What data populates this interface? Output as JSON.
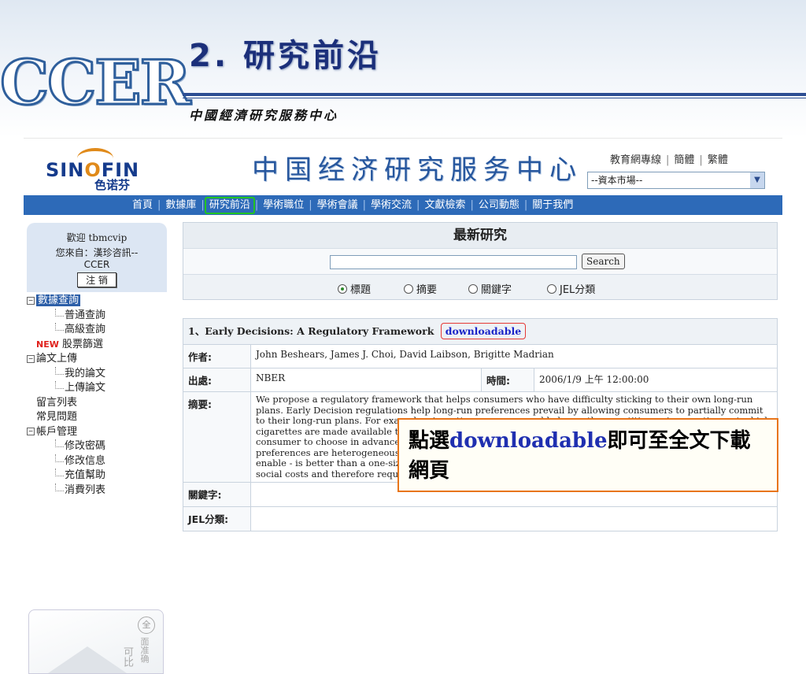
{
  "slide": {
    "logo_text": "CCER",
    "title": "2. 研究前沿",
    "subtitle": "中國經濟研究服務中心"
  },
  "site": {
    "logo_en_pre": "SIN",
    "logo_en_o": "O",
    "logo_en_post": "FIN",
    "logo_cn": "色诺芬",
    "name": "中国经济研究服务中心",
    "top_links": [
      "教育網專線",
      "簡體",
      "繁體"
    ],
    "market_select": {
      "value": "--資本市場--"
    }
  },
  "nav": {
    "items": [
      "首頁",
      "數據庫",
      "研究前沿",
      "學術職位",
      "學術會議",
      "學術交流",
      "文獻檢索",
      "公司動態",
      "關于我們"
    ]
  },
  "sidebar": {
    "welcome": "歡迎 tbmcvip",
    "from_line1": "您來自：漢珍咨訊--",
    "from_line2": "CCER",
    "logout": "注 销",
    "tree": {
      "data_query": "數據查詢",
      "normal_query": "普通查詢",
      "advanced_query": "高級查詢",
      "new_badge": "NEW",
      "stock_screen": "股票篩選",
      "paper_upload": "論文上傳",
      "my_papers": "我的論文",
      "upload_paper": "上傳論文",
      "guestbook": "留言列表",
      "faq": "常見問題",
      "account": "帳戶管理",
      "change_password": "修改密碼",
      "change_info": "修改信息",
      "recharge_help": "充值幫助",
      "spending_list": "消費列表"
    },
    "ad": {
      "circle": "全",
      "vtext": "面准确",
      "vtext2": "可比"
    }
  },
  "search": {
    "title": "最新研究",
    "button": "Search",
    "options": [
      "標題",
      "摘要",
      "關鍵字",
      "JEL分類"
    ],
    "selected": "標題"
  },
  "result": {
    "title": "1、Early Decisions: A Regulatory Framework",
    "download": "downloadable",
    "author_label": "作者:",
    "authors": "John Beshears, James J. Choi, David Laibson, Brigitte Madrian",
    "source_label": "出處:",
    "source": "NBER",
    "time_label": "時間:",
    "time": "2006/1/9 上午 12:00:00",
    "abstract_label": "摘要:",
    "abstract": "We propose a regulatory framework that helps consumers who have difficulty sticking to their own long-run plans. Early Decision regulations help long-run preferences prevail by allowing consumers to partially commit to their long-run plans. For example, cigarette consumers could choose the quantities, prices, or times at which cigarettes are made available to them. In the cigarette market, Early Decision regulations would allow each consumer to choose in advance. Early Decision regulations dominate one-size-fits-all regulation when consumer preferences are heterogeneous. Intuitively, each consumer's self-imposed regulation - which Early Decisions enable - is better than a one-size-fits-all regulation like a sin tax. Of course, Early Decision regulations incur social costs and therefore require empirical evaluation to determine their net social value.",
    "keywords_label": "關鍵字:",
    "keywords": "",
    "jel_label": "JEL分類:",
    "jel": ""
  },
  "callout": {
    "pre": "點選",
    "keyword": "downloadable",
    "post": "即可至全文下載網頁"
  }
}
